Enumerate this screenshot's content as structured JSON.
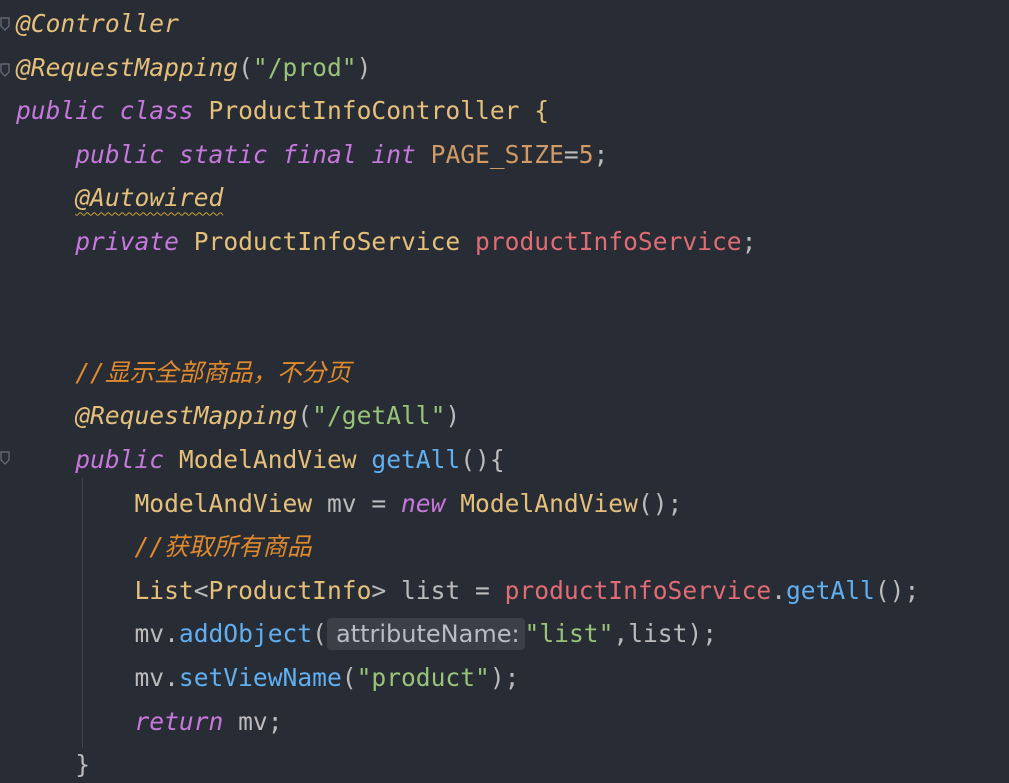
{
  "editor": {
    "lines": [
      [
        {
          "t": "@Controller",
          "c": "an"
        }
      ],
      [
        {
          "t": "@RequestMapping",
          "c": "an"
        },
        {
          "t": "(",
          "c": "pl"
        },
        {
          "t": "\"/prod\"",
          "c": "st"
        },
        {
          "t": ")",
          "c": "pl"
        }
      ],
      [
        {
          "t": "public",
          "c": "kw"
        },
        {
          "t": " ",
          "c": "pl"
        },
        {
          "t": "class",
          "c": "kw"
        },
        {
          "t": " ProductInfoController {",
          "c": "cl"
        }
      ],
      [
        {
          "t": "    ",
          "c": "pl"
        },
        {
          "t": "public",
          "c": "kw"
        },
        {
          "t": " ",
          "c": "pl"
        },
        {
          "t": "static",
          "c": "kw"
        },
        {
          "t": " ",
          "c": "pl"
        },
        {
          "t": "final",
          "c": "kw"
        },
        {
          "t": " ",
          "c": "pl"
        },
        {
          "t": "int",
          "c": "kw"
        },
        {
          "t": " ",
          "c": "pl"
        },
        {
          "t": "PAGE_SIZE",
          "c": "nm"
        },
        {
          "t": "=",
          "c": "pl"
        },
        {
          "t": "5",
          "c": "nm"
        },
        {
          "t": ";",
          "c": "pl"
        }
      ],
      [
        {
          "t": "    ",
          "c": "pl"
        },
        {
          "t": "@Autowired",
          "c": "an squiggle"
        }
      ],
      [
        {
          "t": "    ",
          "c": "pl"
        },
        {
          "t": "private",
          "c": "kw"
        },
        {
          "t": " ",
          "c": "pl"
        },
        {
          "t": "ProductInfoService",
          "c": "cl"
        },
        {
          "t": " ",
          "c": "pl"
        },
        {
          "t": "productInfoService",
          "c": "fd"
        },
        {
          "t": ";",
          "c": "pl"
        }
      ],
      [],
      [],
      [
        {
          "t": "    ",
          "c": "pl"
        },
        {
          "t": "//显示全部商品，不分页",
          "c": "cm"
        }
      ],
      [
        {
          "t": "    ",
          "c": "pl"
        },
        {
          "t": "@RequestMapping",
          "c": "an"
        },
        {
          "t": "(",
          "c": "pl"
        },
        {
          "t": "\"/getAll\"",
          "c": "st"
        },
        {
          "t": ")",
          "c": "pl"
        }
      ],
      [
        {
          "t": "    ",
          "c": "pl"
        },
        {
          "t": "public",
          "c": "kw"
        },
        {
          "t": " ",
          "c": "pl"
        },
        {
          "t": "ModelAndView",
          "c": "cl"
        },
        {
          "t": " ",
          "c": "pl"
        },
        {
          "t": "getAll",
          "c": "fn"
        },
        {
          "t": "(){",
          "c": "pl"
        }
      ],
      [
        {
          "t": "        ",
          "c": "pl"
        },
        {
          "t": "ModelAndView",
          "c": "cl"
        },
        {
          "t": " mv = ",
          "c": "pl"
        },
        {
          "t": "new",
          "c": "kw"
        },
        {
          "t": " ",
          "c": "pl"
        },
        {
          "t": "ModelAndView",
          "c": "cl"
        },
        {
          "t": "();",
          "c": "pl"
        }
      ],
      [
        {
          "t": "        ",
          "c": "pl"
        },
        {
          "t": "//获取所有商品",
          "c": "cm"
        }
      ],
      [
        {
          "t": "        ",
          "c": "pl"
        },
        {
          "t": "List",
          "c": "cl"
        },
        {
          "t": "<",
          "c": "pl"
        },
        {
          "t": "ProductInfo",
          "c": "cl"
        },
        {
          "t": "> list = ",
          "c": "pl"
        },
        {
          "t": "productInfoService",
          "c": "fd"
        },
        {
          "t": ".",
          "c": "pl"
        },
        {
          "t": "getAll",
          "c": "fn"
        },
        {
          "t": "();",
          "c": "pl"
        }
      ],
      [
        {
          "t": "        ",
          "c": "pl"
        },
        {
          "t": "mv.",
          "c": "pl"
        },
        {
          "t": "addObject",
          "c": "fn"
        },
        {
          "t": "(",
          "c": "pl"
        },
        {
          "t": "attributeName:",
          "c": "hint"
        },
        {
          "t": "\"list\"",
          "c": "st"
        },
        {
          "t": ",list);",
          "c": "pl"
        }
      ],
      [
        {
          "t": "        ",
          "c": "pl"
        },
        {
          "t": "mv.",
          "c": "pl"
        },
        {
          "t": "setViewName",
          "c": "fn"
        },
        {
          "t": "(",
          "c": "pl"
        },
        {
          "t": "\"product\"",
          "c": "st"
        },
        {
          "t": ");",
          "c": "pl"
        }
      ],
      [
        {
          "t": "        ",
          "c": "pl"
        },
        {
          "t": "return",
          "c": "kw"
        },
        {
          "t": " mv;",
          "c": "pl"
        }
      ],
      [
        {
          "t": "    }",
          "c": "pl"
        }
      ]
    ]
  },
  "colors": {
    "background": "#282c34",
    "keyword": "#c678dd",
    "annotation": "#e5c07b",
    "string": "#98c379",
    "function": "#61afef",
    "field": "#e06c75",
    "number": "#d19a66",
    "comment": "#e08a2e"
  }
}
